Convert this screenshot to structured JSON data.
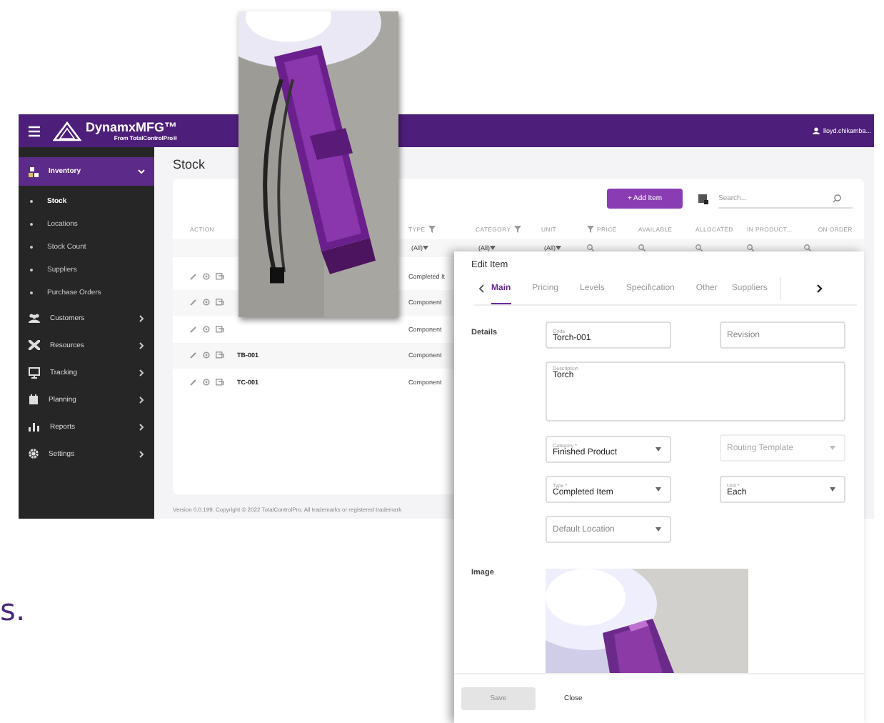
{
  "promo_text": "s.",
  "app": {
    "brand": "DynamxMFG™",
    "brand_sub": "From TotalControlPro®",
    "user": "lloyd.chikamba...",
    "sidebar": {
      "items": [
        {
          "label": "Inventory",
          "selected": true,
          "expanded": true,
          "children": [
            {
              "label": "Stock",
              "selected": true
            },
            {
              "label": "Locations",
              "selected": false
            },
            {
              "label": "Stock Count",
              "selected": false
            },
            {
              "label": "Suppliers",
              "selected": false
            },
            {
              "label": "Purchase Orders",
              "selected": false
            }
          ]
        },
        {
          "label": "Customers",
          "selected": false,
          "expanded": false
        },
        {
          "label": "Resources",
          "selected": false,
          "expanded": false
        },
        {
          "label": "Tracking",
          "selected": false,
          "expanded": false
        },
        {
          "label": "Planning",
          "selected": false,
          "expanded": false
        },
        {
          "label": "Reports",
          "selected": false,
          "expanded": false
        },
        {
          "label": "Settings",
          "selected": false,
          "expanded": false
        }
      ]
    },
    "page_title": "Stock",
    "toolbar": {
      "add_button": "+ Add Item",
      "search": {
        "placeholder": "Search..."
      }
    },
    "table": {
      "columns": [
        {
          "label": "ACTION"
        },
        {},
        {
          "label": "TYPE",
          "filter": true
        },
        {
          "label": "CATEGORY",
          "filter": true
        },
        {
          "label": "UNIT"
        },
        {
          "label": "PRICE",
          "filter": true,
          "filter_first": true
        },
        {
          "label": "AVAILABLE"
        },
        {
          "label": "ALLOCATED"
        },
        {
          "label": "IN PRODUCT..."
        },
        {
          "label": "ON ORDER"
        }
      ],
      "filters": [
        {
          "kind": "none"
        },
        {
          "kind": "none"
        },
        {
          "kind": "dropdown",
          "value": "(All)"
        },
        {
          "kind": "dropdown",
          "value": "(All)"
        },
        {
          "kind": "dropdown",
          "value": "(All)"
        },
        {
          "kind": "search"
        },
        {
          "kind": "search"
        },
        {
          "kind": "search"
        },
        {
          "kind": "search"
        },
        {
          "kind": "search"
        }
      ],
      "rows": [
        {
          "type": "Completed It"
        },
        {
          "type": "Component"
        },
        {
          "type": "Component"
        },
        {
          "code": "TB-001",
          "type": "Component"
        },
        {
          "code": "TC-001",
          "type": "Component"
        }
      ]
    },
    "footer": "Version 0.0.199. Copyright © 2022 TotalControlPro. All trademarks or registered trademark"
  },
  "dialog": {
    "title": "Edit Item",
    "tabs": [
      {
        "label": "Main",
        "selected": true
      },
      {
        "label": "Pricing",
        "selected": false
      },
      {
        "label": "Levels",
        "selected": false
      },
      {
        "label": "Specification",
        "selected": false
      },
      {
        "label": "Other",
        "selected": false
      },
      {
        "label": "Suppliers",
        "selected": false
      }
    ],
    "details_label": "Details",
    "fields": [
      {
        "kind": "text",
        "label": "Code",
        "value": "Torch-001"
      },
      {
        "kind": "text",
        "placeholder": "Revision"
      },
      {
        "kind": "textarea",
        "label": "Description",
        "value": "Torch"
      },
      {
        "kind": "select",
        "label": "Category *",
        "value": "Finished Product"
      },
      {
        "kind": "select",
        "placeholder": "Routing Template",
        "disabled": true
      },
      {
        "kind": "select",
        "label": "Type *",
        "value": "Completed Item"
      },
      {
        "kind": "select",
        "label": "Unit *",
        "value": "Each"
      },
      {
        "kind": "select",
        "placeholder": "Default Location"
      }
    ],
    "image_label": "Image",
    "buttons": [
      {
        "label": "Save",
        "disabled": true
      },
      {
        "label": "Close",
        "disabled": false
      }
    ]
  }
}
